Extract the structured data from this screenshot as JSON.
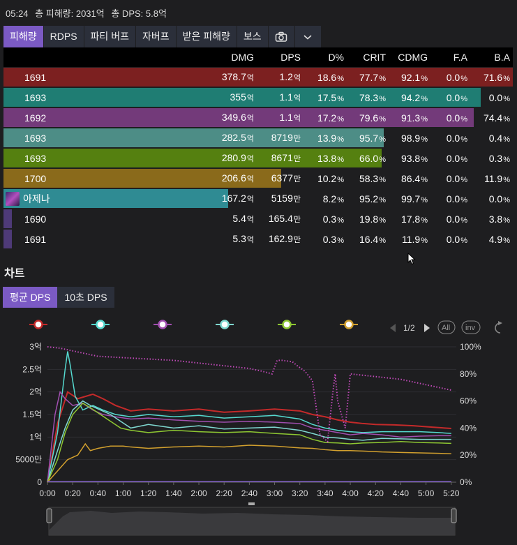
{
  "stats": {
    "time": "05:24",
    "total_damage": "총 피해량: 2031억",
    "total_dps": "총 DPS: 5.8억"
  },
  "tabs": [
    "피해량",
    "RDPS",
    "파티 버프",
    "자버프",
    "받은 피해량",
    "보스"
  ],
  "tab_icons": [
    "camera-icon",
    "chevron-down-icon"
  ],
  "columns": [
    "DMG",
    "DPS",
    "D%",
    "CRIT",
    "CDMG",
    "F.A",
    "B.A"
  ],
  "rows": [
    {
      "name": "1691",
      "dmg": "378.7",
      "dmg_u": "억",
      "dps": "1.2",
      "dps_u": "억",
      "dp": "18.6",
      "crit": "77.7",
      "cdmg": "92.1",
      "fa": "0.0",
      "ba": "71.6",
      "color": "#7c2020",
      "bar": 1.0
    },
    {
      "name": "1693",
      "dmg": "355",
      "dmg_u": "억",
      "dps": "1.1",
      "dps_u": "억",
      "dp": "17.5",
      "crit": "78.3",
      "cdmg": "94.2",
      "fa": "0.0",
      "ba": "0.0",
      "color": "#1f7d73",
      "bar": 0.9374
    },
    {
      "name": "1692",
      "dmg": "349.6",
      "dmg_u": "억",
      "dps": "1.1",
      "dps_u": "억",
      "dp": "17.2",
      "crit": "79.6",
      "cdmg": "91.3",
      "fa": "0.0",
      "ba": "74.4",
      "color": "#733a7a",
      "bar": 0.9231
    },
    {
      "name": "1693",
      "dmg": "282.5",
      "dmg_u": "억",
      "dps": "8719",
      "dps_u": "만",
      "dp": "13.9",
      "crit": "95.7",
      "cdmg": "98.9",
      "fa": "0.0",
      "ba": "0.4",
      "color": "#4d8d86",
      "bar": 0.746
    },
    {
      "name": "1693",
      "dmg": "280.9",
      "dmg_u": "억",
      "dps": "8671",
      "dps_u": "만",
      "dp": "13.8",
      "crit": "66.0",
      "cdmg": "93.8",
      "fa": "0.0",
      "ba": "0.3",
      "color": "#558010",
      "bar": 0.7418
    },
    {
      "name": "1700",
      "dmg": "206.6",
      "dmg_u": "억",
      "dps": "6377",
      "dps_u": "만",
      "dp": "10.2",
      "crit": "58.3",
      "cdmg": "86.4",
      "fa": "0.0",
      "ba": "11.9",
      "color": "#8a6a1b",
      "bar": 0.5456
    },
    {
      "name": "아제나",
      "dmg": "167.2",
      "dmg_u": "억",
      "dps": "5159",
      "dps_u": "만",
      "dp": "8.2",
      "crit": "95.2",
      "cdmg": "99.7",
      "fa": "0.0",
      "ba": "0.0",
      "color": "#2f8b93",
      "bar": 0.4415,
      "avatar": true
    },
    {
      "name": "1690",
      "dmg": "5.4",
      "dmg_u": "억",
      "dps": "165.4",
      "dps_u": "만",
      "dp": "0.3",
      "crit": "19.8",
      "cdmg": "17.8",
      "fa": "0.0",
      "ba": "3.8",
      "color": "#4e3a78",
      "bar": 0.0143
    },
    {
      "name": "1691",
      "dmg": "5.3",
      "dmg_u": "억",
      "dps": "162.9",
      "dps_u": "만",
      "dp": "0.3",
      "crit": "16.4",
      "cdmg": "11.9",
      "fa": "0.0",
      "ba": "4.9",
      "color": "#4e3a78",
      "bar": 0.014
    }
  ],
  "chart_section": {
    "title": "차트",
    "tabs": [
      "평균 DPS",
      "10초 DPS"
    ]
  },
  "legend": {
    "page": "1/2",
    "all_label": "All",
    "inv_label": "inv"
  },
  "chart_data": {
    "type": "line",
    "x_ticks": [
      "0:00",
      "0:20",
      "0:40",
      "1:00",
      "1:20",
      "1:40",
      "2:00",
      "2:20",
      "2:40",
      "3:00",
      "3:20",
      "3:40",
      "4:00",
      "4:20",
      "4:40",
      "5:00",
      "5:20"
    ],
    "y_ticks": [
      "0",
      "5000만",
      "1억",
      "1.5억",
      "2억",
      "2.5억",
      "3억"
    ],
    "y2_ticks": [
      "0%",
      "20%",
      "40%",
      "60%",
      "80%",
      "100%"
    ],
    "ylim": [
      0,
      3
    ],
    "y2lim": [
      0,
      100
    ],
    "xlim": [
      0,
      324
    ],
    "series": [
      {
        "color": "#c42a2a",
        "width": 2,
        "points": [
          [
            0,
            0
          ],
          [
            8,
            1.3
          ],
          [
            16,
            2.0
          ],
          [
            24,
            1.85
          ],
          [
            30,
            1.9
          ],
          [
            36,
            1.95
          ],
          [
            44,
            1.85
          ],
          [
            54,
            1.7
          ],
          [
            66,
            1.58
          ],
          [
            80,
            1.62
          ],
          [
            100,
            1.58
          ],
          [
            120,
            1.62
          ],
          [
            140,
            1.55
          ],
          [
            160,
            1.58
          ],
          [
            180,
            1.62
          ],
          [
            200,
            1.58
          ],
          [
            210,
            1.5
          ],
          [
            220,
            1.45
          ],
          [
            230,
            1.38
          ],
          [
            240,
            1.33
          ],
          [
            250,
            1.3
          ],
          [
            260,
            1.28
          ],
          [
            275,
            1.27
          ],
          [
            290,
            1.25
          ],
          [
            305,
            1.22
          ],
          [
            320,
            1.19
          ]
        ]
      },
      {
        "color": "#55d9cf",
        "width": 1.5,
        "points": [
          [
            0,
            0
          ],
          [
            8,
            1.1
          ],
          [
            14,
            2.5
          ],
          [
            16,
            2.9
          ],
          [
            18,
            2.6
          ],
          [
            22,
            1.9
          ],
          [
            28,
            1.6
          ],
          [
            36,
            1.7
          ],
          [
            44,
            1.6
          ],
          [
            54,
            1.5
          ],
          [
            66,
            1.45
          ],
          [
            80,
            1.5
          ],
          [
            100,
            1.45
          ],
          [
            120,
            1.48
          ],
          [
            140,
            1.42
          ],
          [
            160,
            1.45
          ],
          [
            180,
            1.48
          ],
          [
            200,
            1.4
          ],
          [
            210,
            1.28
          ],
          [
            220,
            1.2
          ],
          [
            230,
            1.15
          ],
          [
            240,
            1.12
          ],
          [
            250,
            1.1
          ],
          [
            265,
            1.12
          ],
          [
            280,
            1.12
          ],
          [
            295,
            1.12
          ],
          [
            310,
            1.1
          ],
          [
            320,
            1.08
          ]
        ]
      },
      {
        "color": "#a14fb0",
        "width": 1.5,
        "points": [
          [
            0,
            0
          ],
          [
            6,
            1.5
          ],
          [
            10,
            2.0
          ],
          [
            14,
            1.85
          ],
          [
            20,
            1.7
          ],
          [
            28,
            1.75
          ],
          [
            36,
            1.6
          ],
          [
            44,
            1.5
          ],
          [
            54,
            1.45
          ],
          [
            66,
            1.4
          ],
          [
            80,
            1.42
          ],
          [
            100,
            1.38
          ],
          [
            120,
            1.35
          ],
          [
            140,
            1.33
          ],
          [
            160,
            1.35
          ],
          [
            180,
            1.33
          ],
          [
            200,
            1.3
          ],
          [
            210,
            1.2
          ],
          [
            220,
            1.15
          ],
          [
            230,
            1.1
          ],
          [
            240,
            1.05
          ],
          [
            250,
            1.08
          ],
          [
            265,
            1.05
          ],
          [
            280,
            1.0
          ],
          [
            295,
            1.02
          ],
          [
            310,
            1.03
          ],
          [
            320,
            1.03
          ]
        ]
      },
      {
        "color": "#7fd8d0",
        "width": 1.5,
        "points": [
          [
            0,
            0
          ],
          [
            8,
            0.7
          ],
          [
            14,
            1.2
          ],
          [
            20,
            1.6
          ],
          [
            28,
            1.8
          ],
          [
            34,
            1.7
          ],
          [
            42,
            1.6
          ],
          [
            50,
            1.5
          ],
          [
            58,
            1.35
          ],
          [
            66,
            1.2
          ],
          [
            80,
            1.28
          ],
          [
            100,
            1.2
          ],
          [
            120,
            1.25
          ],
          [
            140,
            1.18
          ],
          [
            160,
            1.2
          ],
          [
            180,
            1.22
          ],
          [
            200,
            1.15
          ],
          [
            210,
            1.08
          ],
          [
            220,
            1.0
          ],
          [
            230,
            0.98
          ],
          [
            240,
            0.95
          ],
          [
            250,
            0.93
          ],
          [
            265,
            0.97
          ],
          [
            280,
            0.96
          ],
          [
            295,
            0.95
          ],
          [
            310,
            0.95
          ],
          [
            320,
            0.95
          ]
        ]
      },
      {
        "color": "#8ec732",
        "width": 1.5,
        "points": [
          [
            0,
            0
          ],
          [
            8,
            0.5
          ],
          [
            14,
            1.1
          ],
          [
            20,
            1.5
          ],
          [
            28,
            1.75
          ],
          [
            34,
            1.65
          ],
          [
            42,
            1.5
          ],
          [
            50,
            1.35
          ],
          [
            58,
            1.2
          ],
          [
            66,
            1.15
          ],
          [
            80,
            1.1
          ],
          [
            100,
            1.15
          ],
          [
            120,
            1.12
          ],
          [
            140,
            1.1
          ],
          [
            160,
            1.12
          ],
          [
            180,
            1.08
          ],
          [
            200,
            1.05
          ],
          [
            210,
            0.95
          ],
          [
            220,
            0.88
          ],
          [
            230,
            0.87
          ],
          [
            240,
            0.85
          ],
          [
            250,
            0.87
          ],
          [
            265,
            0.88
          ],
          [
            280,
            0.9
          ],
          [
            295,
            0.88
          ],
          [
            310,
            0.87
          ],
          [
            320,
            0.86
          ]
        ]
      },
      {
        "color": "#d2a02e",
        "width": 1.5,
        "points": [
          [
            0,
            0
          ],
          [
            8,
            0.25
          ],
          [
            16,
            0.5
          ],
          [
            24,
            0.6
          ],
          [
            30,
            0.85
          ],
          [
            34,
            0.7
          ],
          [
            40,
            0.75
          ],
          [
            50,
            0.8
          ],
          [
            60,
            0.8
          ],
          [
            66,
            0.78
          ],
          [
            80,
            0.75
          ],
          [
            100,
            0.78
          ],
          [
            120,
            0.8
          ],
          [
            140,
            0.78
          ],
          [
            160,
            0.82
          ],
          [
            180,
            0.8
          ],
          [
            200,
            0.76
          ],
          [
            210,
            0.75
          ],
          [
            220,
            0.72
          ],
          [
            230,
            0.7
          ],
          [
            240,
            0.7
          ],
          [
            250,
            0.69
          ],
          [
            265,
            0.67
          ],
          [
            280,
            0.66
          ],
          [
            295,
            0.65
          ],
          [
            310,
            0.64
          ],
          [
            320,
            0.63
          ]
        ]
      },
      {
        "color": "#7b5ac4",
        "width": 1.5,
        "points": [
          [
            0,
            0.015
          ],
          [
            320,
            0.015
          ]
        ]
      }
    ],
    "series_y2": [
      {
        "color": "#c04ab8",
        "dotted": true,
        "points": [
          [
            0,
            100
          ],
          [
            10,
            99
          ],
          [
            20,
            97
          ],
          [
            30,
            95
          ],
          [
            40,
            93
          ],
          [
            60,
            92
          ],
          [
            80,
            91
          ],
          [
            100,
            90
          ],
          [
            120,
            88
          ],
          [
            140,
            86
          ],
          [
            160,
            84
          ],
          [
            170,
            82
          ],
          [
            178,
            80
          ],
          [
            180,
            85
          ],
          [
            182,
            90
          ],
          [
            186,
            90
          ],
          [
            194,
            89
          ],
          [
            198,
            86
          ],
          [
            204,
            82
          ],
          [
            210,
            75
          ],
          [
            216,
            35
          ],
          [
            222,
            30
          ],
          [
            226,
            65
          ],
          [
            228,
            80
          ],
          [
            230,
            60
          ],
          [
            236,
            40
          ],
          [
            240,
            80
          ],
          [
            250,
            79
          ],
          [
            260,
            78
          ],
          [
            270,
            77
          ],
          [
            280,
            76
          ],
          [
            290,
            74
          ],
          [
            300,
            72
          ],
          [
            310,
            70
          ],
          [
            320,
            68
          ]
        ]
      }
    ]
  }
}
